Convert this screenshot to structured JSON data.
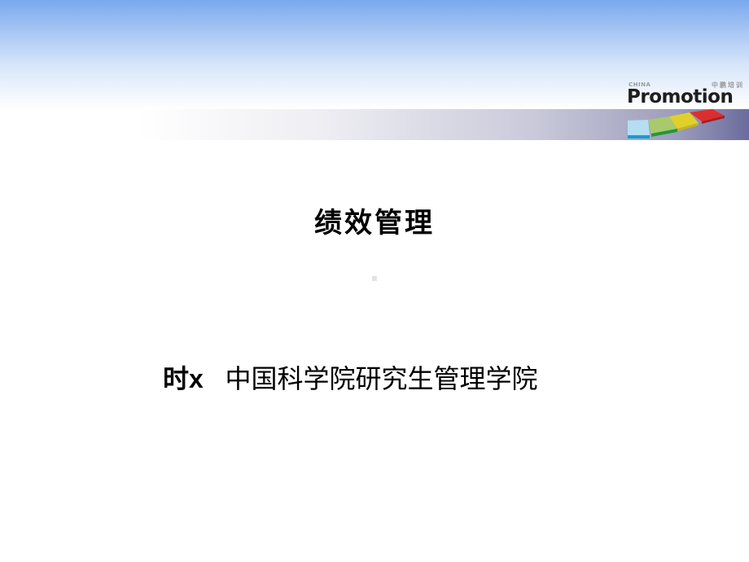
{
  "slide": {
    "title": "绩效管理",
    "presenter": "时x",
    "separator": "   ",
    "affiliation": "中国科学院研究生管理学院"
  },
  "logo": {
    "top_left_text": "CHINA",
    "top_right_text": "中鹏培训",
    "brand_text": "Promotion",
    "icon": "colored-steps-icon",
    "step_colors": [
      "#aedcf0",
      "#a8c86a",
      "#e6d22a",
      "#d83030"
    ]
  },
  "theme": {
    "header_gradient_top": "#79a8ee",
    "band_gradient_end": "#6b6b9e",
    "placeholder_dot": "#e3e3e3"
  }
}
